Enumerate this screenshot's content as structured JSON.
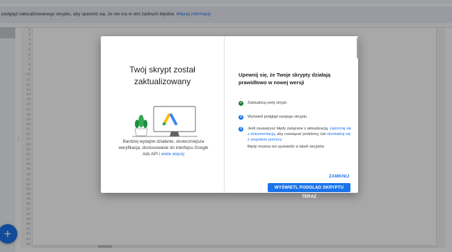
{
  "banner": {
    "message": "podgląd zaktualizowanego skryptu, aby upewnić się, że nie ma w nim żadnych błędów.",
    "link": "Więcej informacji"
  },
  "editor": {
    "line_numbers": [
      "1",
      "2",
      "3",
      "4",
      "5",
      "6",
      "7",
      "8",
      "9",
      "10",
      "11",
      "12",
      "13",
      "14",
      "15",
      "16",
      "17",
      "18",
      "19",
      "20",
      "21",
      "22",
      "23",
      "24",
      "25",
      "26",
      "27",
      "28",
      "29",
      "30",
      "31",
      "32",
      "33",
      "34",
      "35",
      "36",
      "37",
      "38",
      "39",
      "40",
      "41",
      "42",
      "43",
      "44"
    ],
    "add_button_icon": "+"
  },
  "dialog": {
    "left": {
      "title_line1": "Twój skrypt został",
      "title_line2": "zaktualizowany",
      "description": "Bardziej wydajne działanie, skuteczniejsza weryfikacja, dostosowanie do interfejsu Google Ads API i",
      "description_link": "wiele więcej"
    },
    "right": {
      "title": "Upewnij się, że Twoje skrypty działają prawidłowo w nowej wersji",
      "steps": [
        {
          "icon": "✓",
          "status": "done",
          "text": "Zaktualizuj swój skrypt"
        },
        {
          "icon": "2",
          "status": "pending",
          "text": "Wyświetl podgląd swojego skryptu"
        },
        {
          "icon": "3",
          "status": "pending",
          "text_before": "Jeśli zauważysz błędy związane z aktualizacją,",
          "link1": "zapoznaj się z dokumentacją",
          "text_mid": ", aby rozwiązać problemy, lub",
          "link2": "skontaktuj się z zespołem pomocy"
        }
      ],
      "note": "Błędy możesz też wyświetlić w tabeli skryptów"
    },
    "close_label": "ZAMKNIJ",
    "preview_label": "WYŚWIETL PODGLĄD SKRYPTU TERAZ"
  },
  "colors": {
    "accent": "#1a73e8",
    "success": "#188038",
    "overlay": "rgba(0,0,0,0.34)"
  }
}
